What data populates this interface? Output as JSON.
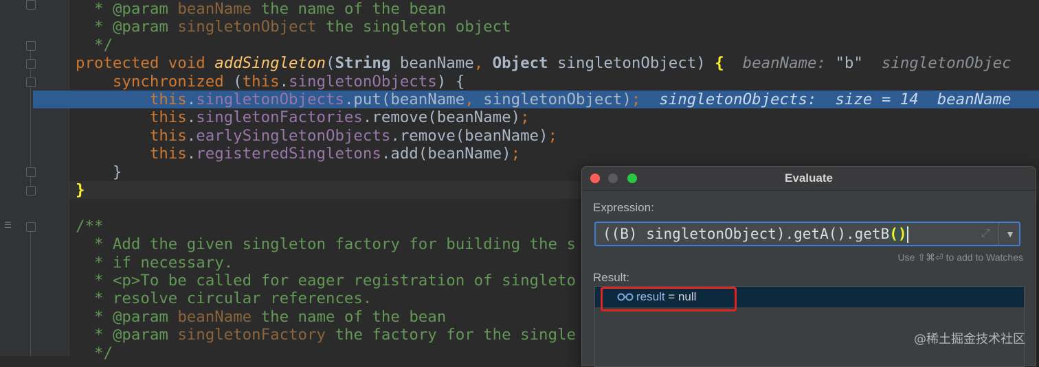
{
  "editor": {
    "lines": [
      {
        "indent": "  ",
        "segments": [
          {
            "cls": "doc",
            "t": "* "
          },
          {
            "cls": "doc-tag",
            "t": "@param "
          },
          {
            "cls": "doc-param",
            "t": "beanName"
          },
          {
            "cls": "doc",
            "t": " the name of the bean"
          }
        ]
      },
      {
        "indent": "  ",
        "segments": [
          {
            "cls": "doc",
            "t": "* "
          },
          {
            "cls": "doc-tag",
            "t": "@param "
          },
          {
            "cls": "doc-param",
            "t": "singletonObject"
          },
          {
            "cls": "doc",
            "t": " the singleton object"
          }
        ]
      },
      {
        "indent": "  ",
        "segments": [
          {
            "cls": "doc",
            "t": "*/"
          }
        ]
      },
      {
        "indent": "",
        "segments": [
          {
            "cls": "kw",
            "t": "protected void "
          },
          {
            "cls": "fn",
            "t": "addSingleton"
          },
          {
            "cls": "",
            "t": "("
          },
          {
            "cls": "type",
            "t": "String"
          },
          {
            "cls": "",
            "t": " beanName"
          },
          {
            "cls": "kw",
            "t": ", "
          },
          {
            "cls": "type",
            "t": "Object"
          },
          {
            "cls": "",
            "t": " singletonObject) "
          },
          {
            "cls": "brace-hl",
            "t": "{"
          },
          {
            "cls": "inline-hint",
            "t": "  beanName: "
          },
          {
            "cls": "hint-str",
            "t": "\"b\""
          },
          {
            "cls": "inline-hint",
            "t": "  singletonObjec"
          }
        ]
      },
      {
        "indent": "    ",
        "segments": [
          {
            "cls": "kw",
            "t": "synchronized "
          },
          {
            "cls": "",
            "t": "("
          },
          {
            "cls": "kw",
            "t": "this"
          },
          {
            "cls": "",
            "t": "."
          },
          {
            "cls": "field",
            "t": "singletonObjects"
          },
          {
            "cls": "",
            "t": ") {"
          }
        ]
      },
      {
        "indent": "        ",
        "exec": true,
        "segments": [
          {
            "cls": "kw",
            "t": "this"
          },
          {
            "cls": "",
            "t": "."
          },
          {
            "cls": "field",
            "t": "singletonObjects"
          },
          {
            "cls": "",
            "t": ".put(beanName"
          },
          {
            "cls": "kw",
            "t": ", "
          },
          {
            "cls": "",
            "t": "singletonObject)"
          },
          {
            "cls": "kw",
            "t": ";"
          },
          {
            "cls": "exec-hint",
            "t": "  singletonObjects:  size = 14  beanName"
          }
        ]
      },
      {
        "indent": "        ",
        "segments": [
          {
            "cls": "kw",
            "t": "this"
          },
          {
            "cls": "",
            "t": "."
          },
          {
            "cls": "field",
            "t": "singletonFactories"
          },
          {
            "cls": "",
            "t": ".remove(beanName)"
          },
          {
            "cls": "kw",
            "t": ";"
          }
        ]
      },
      {
        "indent": "        ",
        "segments": [
          {
            "cls": "kw",
            "t": "this"
          },
          {
            "cls": "",
            "t": "."
          },
          {
            "cls": "field",
            "t": "earlySingletonObjects"
          },
          {
            "cls": "",
            "t": ".remove(beanName)"
          },
          {
            "cls": "kw",
            "t": ";"
          }
        ]
      },
      {
        "indent": "        ",
        "segments": [
          {
            "cls": "kw",
            "t": "this"
          },
          {
            "cls": "",
            "t": "."
          },
          {
            "cls": "field",
            "t": "registeredSingletons"
          },
          {
            "cls": "",
            "t": ".add(beanName)"
          },
          {
            "cls": "kw",
            "t": ";"
          }
        ]
      },
      {
        "indent": "    ",
        "segments": [
          {
            "cls": "",
            "t": "}"
          }
        ]
      },
      {
        "indent": "",
        "current": true,
        "segments": [
          {
            "cls": "brace-hl",
            "t": "}"
          }
        ]
      },
      {
        "indent": "",
        "segments": [
          {
            "cls": "",
            "t": ""
          }
        ]
      },
      {
        "indent": "",
        "segments": [
          {
            "cls": "doc",
            "t": "/**"
          }
        ]
      },
      {
        "indent": "  ",
        "segments": [
          {
            "cls": "doc",
            "t": "* Add the given singleton factory for building the s"
          }
        ]
      },
      {
        "indent": "  ",
        "segments": [
          {
            "cls": "doc",
            "t": "* if necessary."
          }
        ]
      },
      {
        "indent": "  ",
        "segments": [
          {
            "cls": "doc",
            "t": "* <p>To be called for eager registration of singleto"
          }
        ]
      },
      {
        "indent": "  ",
        "segments": [
          {
            "cls": "doc",
            "t": "* resolve circular references."
          }
        ]
      },
      {
        "indent": "  ",
        "segments": [
          {
            "cls": "doc",
            "t": "* "
          },
          {
            "cls": "doc-tag",
            "t": "@param "
          },
          {
            "cls": "doc-param",
            "t": "beanName"
          },
          {
            "cls": "doc",
            "t": " the name of the bean"
          }
        ]
      },
      {
        "indent": "  ",
        "segments": [
          {
            "cls": "doc",
            "t": "* "
          },
          {
            "cls": "doc-tag",
            "t": "@param "
          },
          {
            "cls": "doc-param",
            "t": "singletonFactory"
          },
          {
            "cls": "doc",
            "t": " the factory for the single"
          }
        ]
      },
      {
        "indent": "  ",
        "segments": [
          {
            "cls": "doc",
            "t": "*/"
          }
        ]
      }
    ]
  },
  "dialog": {
    "title": "Evaluate",
    "expression_label": "Expression:",
    "expression_value": "((B) singletonObject).getA().getB",
    "expression_paren": "()",
    "watch_hint": "Use ⇧⌘⏎ to add to Watches",
    "result_label": "Result:",
    "result_name": "result",
    "result_rest": " = null"
  },
  "watermark": "@稀土掘金技术社区",
  "colors": {
    "editor_bg": "#2b2b2b",
    "exec_line": "#2d5b92",
    "keyword": "#cc7832",
    "doc_comment": "#629755",
    "field": "#9876aa",
    "highlight_outline": "#e0241f"
  }
}
